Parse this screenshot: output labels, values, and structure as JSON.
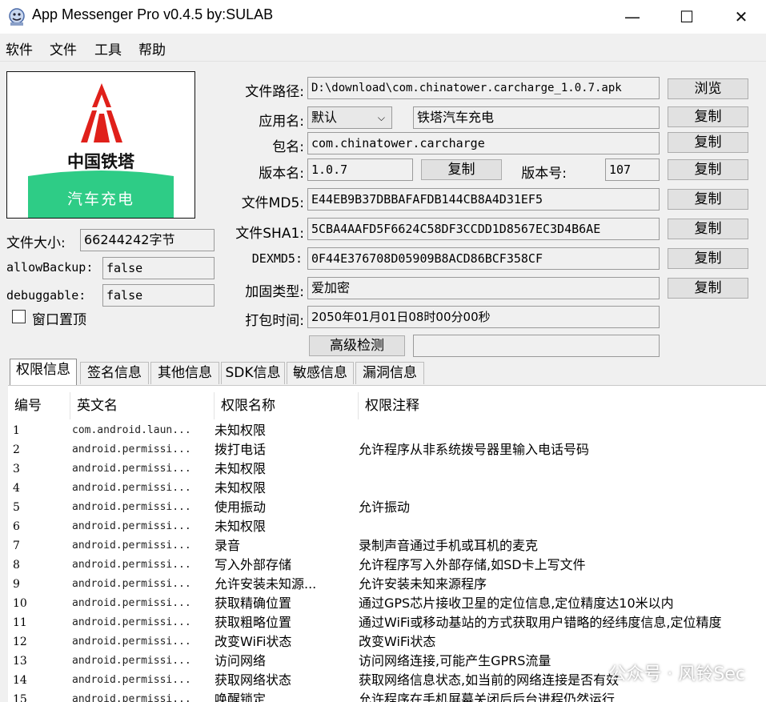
{
  "window": {
    "title": "App Messenger Pro v0.4.5    by:SULAB",
    "minimize": "—",
    "maximize": "☐",
    "close": "✕"
  },
  "menu": [
    "软件",
    "文件",
    "工具",
    "帮助"
  ],
  "logo": {
    "company": "中国铁塔",
    "service": "汽车充电",
    "brand_color": "#e0201a",
    "band_color": "#2ecc86"
  },
  "left": {
    "file_size_label": "文件大小:",
    "file_size": "66244242字节",
    "allow_backup_label": "allowBackup:",
    "allow_backup": "false",
    "debuggable_label": "debuggable:",
    "debuggable": "false",
    "window_top_label": "窗口置顶"
  },
  "fields": {
    "file_path_label": "文件路径:",
    "file_path": "D:\\download\\com.chinatower.carcharge_1.0.7.apk",
    "browse": "浏览",
    "app_name_label": "应用名:",
    "app_name_select": "默认",
    "app_name": "铁塔汽车充电",
    "package_label": "包名:",
    "package": "com.chinatower.carcharge",
    "version_name_label": "版本名:",
    "version_name": "1.0.7",
    "version_code_label": "版本号:",
    "version_code": "107",
    "md5_label": "文件MD5:",
    "md5": "E44EB9B37DBBAFAFDB144CB8A4D31EF5",
    "sha1_label": "文件SHA1:",
    "sha1": "5CBA4AAFD5F6624C58DF3CCDD1D8567EC3D4B6AE",
    "dexmd5_label": "DEXMD5:",
    "dexmd5": "0F44E376708D05909B8ACD86BCF358CF",
    "packer_label": "加固类型:",
    "packer": "爱加密",
    "pack_time_label": "打包时间:",
    "pack_time": "2050年01月01日08时00分00秒",
    "copy": "复制",
    "advanced": "高级检测"
  },
  "tabs": [
    "权限信息",
    "签名信息",
    "其他信息",
    "SDK信息",
    "敏感信息",
    "漏洞信息"
  ],
  "table": {
    "headers": [
      "编号",
      "英文名",
      "权限名称",
      "权限注释"
    ],
    "rows": [
      [
        "1",
        "com.android.laun...",
        "未知权限",
        ""
      ],
      [
        "2",
        "android.permissi...",
        "拨打电话",
        "允许程序从非系统拨号器里输入电话号码"
      ],
      [
        "3",
        "android.permissi...",
        "未知权限",
        ""
      ],
      [
        "4",
        "android.permissi...",
        "未知权限",
        ""
      ],
      [
        "5",
        "android.permissi...",
        "使用振动",
        "允许振动"
      ],
      [
        "6",
        "android.permissi...",
        "未知权限",
        ""
      ],
      [
        "7",
        "android.permissi...",
        "录音",
        "录制声音通过手机或耳机的麦克"
      ],
      [
        "8",
        "android.permissi...",
        "写入外部存储",
        "允许程序写入外部存储,如SD卡上写文件"
      ],
      [
        "9",
        "android.permissi...",
        "允许安装未知源...",
        "允许安装未知来源程序"
      ],
      [
        "10",
        "android.permissi...",
        "获取精确位置",
        "通过GPS芯片接收卫星的定位信息,定位精度达10米以内"
      ],
      [
        "11",
        "android.permissi...",
        "获取粗略位置",
        "通过WiFi或移动基站的方式获取用户错略的经纬度信息,定位精度"
      ],
      [
        "12",
        "android.permissi...",
        "改变WiFi状态",
        "改变WiFi状态"
      ],
      [
        "13",
        "android.permissi...",
        "访问网络",
        "访问网络连接,可能产生GPRS流量"
      ],
      [
        "14",
        "android.permissi...",
        "获取网络状态",
        "获取网络信息状态,如当前的网络连接是否有效"
      ],
      [
        "15",
        "android.permissi...",
        "唤醒锁定",
        "允许程序在手机屏幕关闭后后台进程仍然运行"
      ]
    ]
  },
  "watermark": "公众号 · 风铃Sec"
}
